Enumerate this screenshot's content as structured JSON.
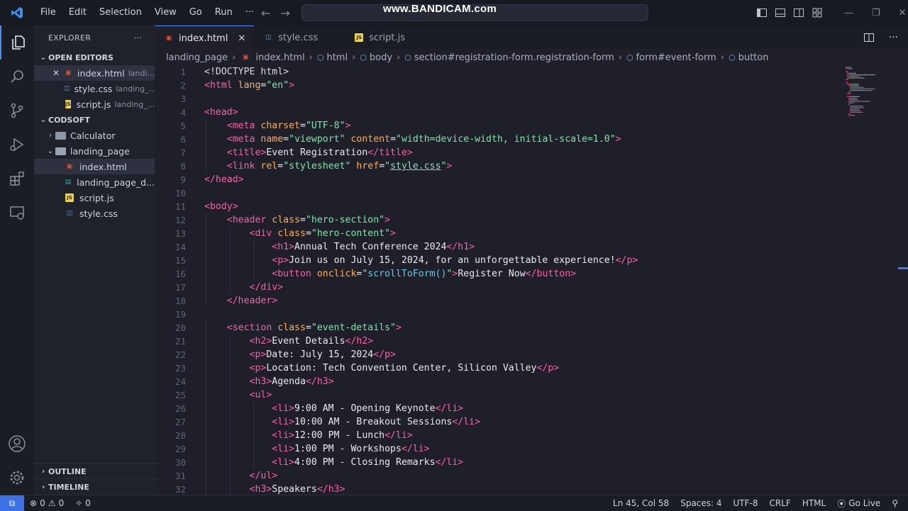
{
  "titlebar": {
    "menu": [
      "File",
      "Edit",
      "Selection",
      "View",
      "Go",
      "Run",
      "···"
    ],
    "watermark": "www.BANDICAM.com"
  },
  "activity_bar": {
    "items": [
      "explorer-icon",
      "search-icon",
      "source-control-icon",
      "run-debug-icon",
      "extensions-icon",
      "remote-explorer-icon",
      "account-icon",
      "settings-gear-icon"
    ]
  },
  "sidebar": {
    "title": "EXPLORER",
    "more": "···",
    "open_editors_title": "OPEN EDITORS",
    "open_editors": [
      {
        "name": "index.html",
        "folder": "landi...",
        "type": "html",
        "active": true
      },
      {
        "name": "style.css",
        "folder": "landing_...",
        "type": "css"
      },
      {
        "name": "script.js",
        "folder": "landing_...",
        "type": "js"
      }
    ],
    "workspace_title": "CODSOFT",
    "tree": [
      {
        "name": "Calculator",
        "kind": "folder",
        "expanded": false,
        "depth": 1
      },
      {
        "name": "landing_page",
        "kind": "folder",
        "expanded": true,
        "depth": 1
      },
      {
        "name": "index.html",
        "kind": "html",
        "depth": 2,
        "selected": true
      },
      {
        "name": "landing_page_d...",
        "kind": "md",
        "depth": 2
      },
      {
        "name": "script.js",
        "kind": "js",
        "depth": 2
      },
      {
        "name": "style.css",
        "kind": "css",
        "depth": 2
      }
    ],
    "outline": "OUTLINE",
    "timeline": "TIMELINE"
  },
  "tabs": [
    {
      "label": "index.html",
      "type": "html",
      "active": true
    },
    {
      "label": "style.css",
      "type": "css"
    },
    {
      "label": "script.js",
      "type": "js"
    }
  ],
  "breadcrumb": [
    "landing_page",
    "index.html",
    "html",
    "body",
    "section#registration-form.registration-form",
    "form#event-form",
    "button"
  ],
  "code_lines": [
    {
      "n": 1,
      "indent": 0,
      "tokens": [
        [
          "doc",
          "<!DOCTYPE html>"
        ]
      ]
    },
    {
      "n": 2,
      "indent": 0,
      "tokens": [
        [
          "tag",
          "<html "
        ],
        [
          "attr",
          "lang"
        ],
        [
          "text",
          "="
        ],
        [
          "str",
          "\"en\""
        ],
        [
          "tag",
          ">"
        ]
      ]
    },
    {
      "n": 3,
      "indent": 0,
      "tokens": []
    },
    {
      "n": 4,
      "indent": 0,
      "tokens": [
        [
          "tag",
          "<head>"
        ]
      ]
    },
    {
      "n": 5,
      "indent": 1,
      "tokens": [
        [
          "tag",
          "<meta "
        ],
        [
          "attr",
          "charset"
        ],
        [
          "text",
          "="
        ],
        [
          "str",
          "\"UTF-8\""
        ],
        [
          "tag",
          ">"
        ]
      ]
    },
    {
      "n": 6,
      "indent": 1,
      "tokens": [
        [
          "tag",
          "<meta "
        ],
        [
          "attr",
          "name"
        ],
        [
          "text",
          "="
        ],
        [
          "str",
          "\"viewport\""
        ],
        [
          "text",
          " "
        ],
        [
          "attr",
          "content"
        ],
        [
          "text",
          "="
        ],
        [
          "str",
          "\"width=device-width, initial-scale=1.0\""
        ],
        [
          "tag",
          ">"
        ]
      ]
    },
    {
      "n": 7,
      "indent": 1,
      "tokens": [
        [
          "tag",
          "<title>"
        ],
        [
          "text",
          "Event Registration"
        ],
        [
          "tag",
          "</title>"
        ]
      ]
    },
    {
      "n": 8,
      "indent": 1,
      "tokens": [
        [
          "tag",
          "<link "
        ],
        [
          "attr",
          "rel"
        ],
        [
          "text",
          "="
        ],
        [
          "str",
          "\"stylesheet\""
        ],
        [
          "text",
          " "
        ],
        [
          "attr",
          "href"
        ],
        [
          "text",
          "="
        ],
        [
          "str",
          "\""
        ],
        [
          "link",
          "style.css"
        ],
        [
          "str",
          "\""
        ],
        [
          "tag",
          ">"
        ]
      ]
    },
    {
      "n": 9,
      "indent": 0,
      "tokens": [
        [
          "tag",
          "</head>"
        ]
      ]
    },
    {
      "n": 10,
      "indent": 0,
      "tokens": []
    },
    {
      "n": 11,
      "indent": 0,
      "tokens": [
        [
          "tag",
          "<body>"
        ]
      ]
    },
    {
      "n": 12,
      "indent": 1,
      "tokens": [
        [
          "tag",
          "<header "
        ],
        [
          "attr",
          "class"
        ],
        [
          "text",
          "="
        ],
        [
          "str",
          "\"hero-section\""
        ],
        [
          "tag",
          ">"
        ]
      ]
    },
    {
      "n": 13,
      "indent": 2,
      "tokens": [
        [
          "tag",
          "<div "
        ],
        [
          "attr",
          "class"
        ],
        [
          "text",
          "="
        ],
        [
          "str",
          "\"hero-content\""
        ],
        [
          "tag",
          ">"
        ]
      ]
    },
    {
      "n": 14,
      "indent": 3,
      "tokens": [
        [
          "tag",
          "<h1>"
        ],
        [
          "text",
          "Annual Tech Conference 2024"
        ],
        [
          "tag",
          "</h1>"
        ]
      ]
    },
    {
      "n": 15,
      "indent": 3,
      "tokens": [
        [
          "tag",
          "<p>"
        ],
        [
          "text",
          "Join us on July 15, 2024, for an unforgettable experience!"
        ],
        [
          "tag",
          "</p>"
        ]
      ]
    },
    {
      "n": 16,
      "indent": 3,
      "tokens": [
        [
          "tag",
          "<button "
        ],
        [
          "attr",
          "onclick"
        ],
        [
          "text",
          "="
        ],
        [
          "str",
          "\""
        ],
        [
          "fn",
          "scrollToForm()"
        ],
        [
          "str",
          "\""
        ],
        [
          "tag",
          ">"
        ],
        [
          "text",
          "Register Now"
        ],
        [
          "tag",
          "</button>"
        ]
      ]
    },
    {
      "n": 17,
      "indent": 2,
      "tokens": [
        [
          "tag",
          "</div>"
        ]
      ]
    },
    {
      "n": 18,
      "indent": 1,
      "tokens": [
        [
          "tag",
          "</header>"
        ]
      ]
    },
    {
      "n": 19,
      "indent": 0,
      "tokens": []
    },
    {
      "n": 20,
      "indent": 1,
      "tokens": [
        [
          "tag",
          "<section "
        ],
        [
          "attr",
          "class"
        ],
        [
          "text",
          "="
        ],
        [
          "str",
          "\"event-details\""
        ],
        [
          "tag",
          ">"
        ]
      ]
    },
    {
      "n": 21,
      "indent": 2,
      "tokens": [
        [
          "tag",
          "<h2>"
        ],
        [
          "text",
          "Event Details"
        ],
        [
          "tag",
          "</h2>"
        ]
      ]
    },
    {
      "n": 22,
      "indent": 2,
      "tokens": [
        [
          "tag",
          "<p>"
        ],
        [
          "text",
          "Date: July 15, 2024"
        ],
        [
          "tag",
          "</p>"
        ]
      ]
    },
    {
      "n": 23,
      "indent": 2,
      "tokens": [
        [
          "tag",
          "<p>"
        ],
        [
          "text",
          "Location: Tech Convention Center, Silicon Valley"
        ],
        [
          "tag",
          "</p>"
        ]
      ]
    },
    {
      "n": 24,
      "indent": 2,
      "tokens": [
        [
          "tag",
          "<h3>"
        ],
        [
          "text",
          "Agenda"
        ],
        [
          "tag",
          "</h3>"
        ]
      ]
    },
    {
      "n": 25,
      "indent": 2,
      "tokens": [
        [
          "tag",
          "<ul>"
        ]
      ]
    },
    {
      "n": 26,
      "indent": 3,
      "tokens": [
        [
          "tag",
          "<li>"
        ],
        [
          "text",
          "9:00 AM - Opening Keynote"
        ],
        [
          "tag",
          "</li>"
        ]
      ]
    },
    {
      "n": 27,
      "indent": 3,
      "tokens": [
        [
          "tag",
          "<li>"
        ],
        [
          "text",
          "10:00 AM - Breakout Sessions"
        ],
        [
          "tag",
          "</li>"
        ]
      ]
    },
    {
      "n": 28,
      "indent": 3,
      "tokens": [
        [
          "tag",
          "<li>"
        ],
        [
          "text",
          "12:00 PM - Lunch"
        ],
        [
          "tag",
          "</li>"
        ]
      ]
    },
    {
      "n": 29,
      "indent": 3,
      "tokens": [
        [
          "tag",
          "<li>"
        ],
        [
          "text",
          "1:00 PM - Workshops"
        ],
        [
          "tag",
          "</li>"
        ]
      ]
    },
    {
      "n": 30,
      "indent": 3,
      "tokens": [
        [
          "tag",
          "<li>"
        ],
        [
          "text",
          "4:00 PM - Closing Remarks"
        ],
        [
          "tag",
          "</li>"
        ]
      ]
    },
    {
      "n": 31,
      "indent": 2,
      "tokens": [
        [
          "tag",
          "</ul>"
        ]
      ]
    },
    {
      "n": 32,
      "indent": 2,
      "tokens": [
        [
          "tag",
          "<h3>"
        ],
        [
          "text",
          "Speakers"
        ],
        [
          "tag",
          "</h3>"
        ]
      ]
    }
  ],
  "statusbar": {
    "errors": "0",
    "warnings": "0",
    "ports": "0",
    "position": "Ln 45, Col 58",
    "spaces": "Spaces: 4",
    "encoding": "UTF-8",
    "eol": "CRLF",
    "language": "HTML",
    "golive": "Go Live"
  },
  "colors": {
    "accent": "#4a8df8",
    "tag": "#ff5fa8",
    "attr": "#ffaf4e",
    "string": "#80e3a9",
    "function": "#5ccfe6"
  }
}
